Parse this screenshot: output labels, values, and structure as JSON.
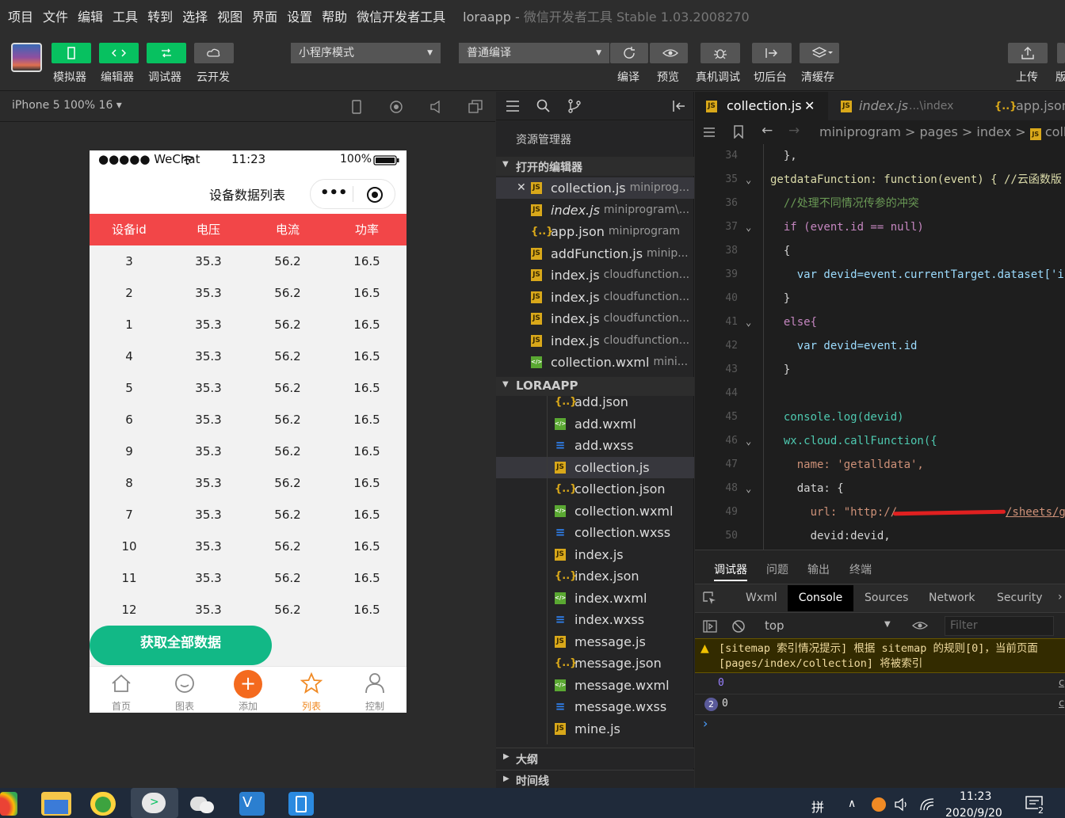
{
  "menubar": {
    "items": [
      "项目",
      "文件",
      "编辑",
      "工具",
      "转到",
      "选择",
      "视图",
      "界面",
      "设置",
      "帮助",
      "微信开发者工具"
    ],
    "app": "loraapp",
    "subtitle": "微信开发者工具 Stable 1.03.2008270"
  },
  "toolbar": {
    "simulator": "模拟器",
    "editor": "编辑器",
    "debugger": "调试器",
    "cloud": "云开发",
    "mode": "小程序模式",
    "compile_mode": "普通编译",
    "compile": "编译",
    "preview": "预览",
    "real_debug": "真机调试",
    "background": "切后台",
    "clear_cache": "清缓存",
    "upload": "上传",
    "version": "版"
  },
  "sim": {
    "device": "iPhone 5 100% 16 ▾"
  },
  "phone": {
    "carrier": "●●●●● WeChat",
    "time": "11:23",
    "battery": "100%",
    "title": "设备数据列表",
    "menu_dots": "•••",
    "headers": [
      "设备id",
      "电压",
      "电流",
      "功率"
    ],
    "rows": [
      [
        "3",
        "35.3",
        "56.2",
        "16.5"
      ],
      [
        "2",
        "35.3",
        "56.2",
        "16.5"
      ],
      [
        "1",
        "35.3",
        "56.2",
        "16.5"
      ],
      [
        "4",
        "35.3",
        "56.2",
        "16.5"
      ],
      [
        "5",
        "35.3",
        "56.2",
        "16.5"
      ],
      [
        "6",
        "35.3",
        "56.2",
        "16.5"
      ],
      [
        "9",
        "35.3",
        "56.2",
        "16.5"
      ],
      [
        "8",
        "35.3",
        "56.2",
        "16.5"
      ],
      [
        "7",
        "35.3",
        "56.2",
        "16.5"
      ],
      [
        "10",
        "35.3",
        "56.2",
        "16.5"
      ],
      [
        "11",
        "35.3",
        "56.2",
        "16.5"
      ],
      [
        "12",
        "35.3",
        "56.2",
        "16.5"
      ]
    ],
    "button": "获取全部数据",
    "tabs": [
      "首页",
      "图表",
      "添加",
      "列表",
      "控制"
    ],
    "add_glyph": "+",
    "tab_active_color": "#f08a24",
    "accent": "#f24648",
    "button_color": "#12b886"
  },
  "explorer": {
    "title": "资源管理器",
    "open_editors": "打开的编辑器",
    "project": "LORAAPP",
    "outline": "大纲",
    "timeline": "时间线",
    "open": [
      {
        "icon": "js",
        "name": "collection.js",
        "path": "miniprog...",
        "close": "✕"
      },
      {
        "icon": "js",
        "name": "index.js",
        "path": "miniprogram\\..."
      },
      {
        "icon": "json",
        "name": "app.json",
        "path": "miniprogram"
      },
      {
        "icon": "js",
        "name": "addFunction.js",
        "path": "minip..."
      },
      {
        "icon": "js",
        "name": "index.js",
        "path": "cloudfunction..."
      },
      {
        "icon": "js",
        "name": "index.js",
        "path": "cloudfunction..."
      },
      {
        "icon": "js",
        "name": "index.js",
        "path": "cloudfunction..."
      },
      {
        "icon": "js",
        "name": "index.js",
        "path": "cloudfunction..."
      },
      {
        "icon": "wxml",
        "name": "collection.wxml",
        "path": "mini..."
      }
    ],
    "tree": [
      {
        "icon": "json",
        "name": "add.json"
      },
      {
        "icon": "wxml",
        "name": "add.wxml"
      },
      {
        "icon": "wxss",
        "name": "add.wxss"
      },
      {
        "icon": "js",
        "name": "collection.js"
      },
      {
        "icon": "json",
        "name": "collection.json"
      },
      {
        "icon": "wxml",
        "name": "collection.wxml"
      },
      {
        "icon": "wxss",
        "name": "collection.wxss"
      },
      {
        "icon": "js",
        "name": "index.js"
      },
      {
        "icon": "json",
        "name": "index.json"
      },
      {
        "icon": "wxml",
        "name": "index.wxml"
      },
      {
        "icon": "wxss",
        "name": "index.wxss"
      },
      {
        "icon": "js",
        "name": "message.js"
      },
      {
        "icon": "json",
        "name": "message.json"
      },
      {
        "icon": "wxml",
        "name": "message.wxml"
      },
      {
        "icon": "wxss",
        "name": "message.wxss"
      },
      {
        "icon": "js",
        "name": "mine.js"
      }
    ]
  },
  "editor": {
    "tabs": [
      {
        "name": "collection.js",
        "close": "✕"
      },
      {
        "name": "index.js",
        "path": "...\\index"
      },
      {
        "name": "app.json"
      }
    ],
    "breadcrumb": [
      "miniprogram",
      ">",
      "pages",
      ">",
      "index",
      ">",
      "colle"
    ],
    "lines": [
      {
        "n": "34",
        "text": "  },",
        "fold": ""
      },
      {
        "n": "35",
        "text": "getdataFunction: function(event) { //云函数版",
        "fold": "⌄"
      },
      {
        "n": "36",
        "text": "  //处理不同情况传参的冲突",
        "fold": ""
      },
      {
        "n": "37",
        "text": "  if (event.id == null)",
        "fold": "⌄"
      },
      {
        "n": "38",
        "text": "  {",
        "fold": ""
      },
      {
        "n": "39",
        "text": "    var devid=event.currentTarget.dataset['i",
        "fold": ""
      },
      {
        "n": "40",
        "text": "  }",
        "fold": ""
      },
      {
        "n": "41",
        "text": "  else{",
        "fold": "⌄"
      },
      {
        "n": "42",
        "text": "    var devid=event.id",
        "fold": ""
      },
      {
        "n": "43",
        "text": "  }",
        "fold": ""
      },
      {
        "n": "44",
        "text": "",
        "fold": ""
      },
      {
        "n": "45",
        "text": "  console.log(devid)",
        "fold": ""
      },
      {
        "n": "46",
        "text": "  wx.cloud.callFunction({",
        "fold": "⌄"
      },
      {
        "n": "47",
        "text": "    name: 'getalldata',",
        "fold": ""
      },
      {
        "n": "48",
        "text": "    data: {",
        "fold": "⌄"
      },
      {
        "n": "49",
        "text": "      url: \"http://",
        "url_tail": "/sheets/g",
        "fold": ""
      },
      {
        "n": "50",
        "text": "      devid:devid,",
        "fold": ""
      }
    ]
  },
  "debug": {
    "tabs": [
      "调试器",
      "问题",
      "输出",
      "终端"
    ],
    "subtabs": [
      "Wxml",
      "Console",
      "Sources",
      "Network",
      "Security"
    ],
    "context": "top",
    "filter_placeholder": "Filter",
    "warning": "[sitemap 索引情况提示] 根据 sitemap 的规则[0]，当前页面 [pages/index/collection] 将被索引",
    "log1": "0",
    "log2_count": "2",
    "log2": "0",
    "prompt": "›",
    "link": "c"
  },
  "taskbar": {
    "time": "11:23",
    "date": "2020/9/20",
    "ime": "拼",
    "notif": "2"
  }
}
